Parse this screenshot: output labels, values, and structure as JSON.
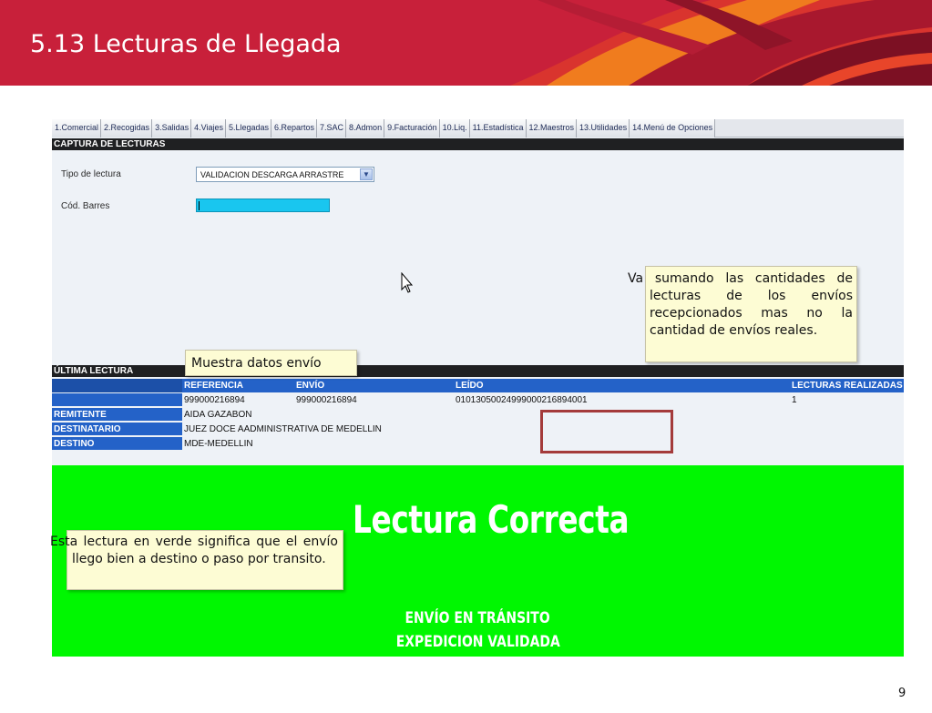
{
  "slide": {
    "title": "5.13 Lecturas de Llegada",
    "page_number": "9",
    "banner_color": "#c8203a"
  },
  "tabs": [
    "1.Comercial",
    "2.Recogidas",
    "3.Salidas",
    "4.Viajes",
    "5.Llegadas",
    "6.Repartos",
    "7.SAC",
    "8.Admon",
    "9.Facturación",
    "10.Liq.",
    "11.Estadística",
    "12.Maestros",
    "13.Utilidades",
    "14.Menú de Opciones"
  ],
  "capture": {
    "section_title": "CAPTURA DE LECTURAS",
    "tipo_label": "Tipo de lectura",
    "tipo_value": "VALIDACION DESCARGA ARRASTRE",
    "barcode_label": "Cód. Barres"
  },
  "ultima": {
    "section_title": "ÚLTIMA LECTURA",
    "headers": {
      "referencia": "REFERENCIA",
      "envio": "ENVÍO",
      "leido": "LEÍDO",
      "lecturas": "LECTURAS REALIZADAS"
    },
    "values": {
      "referencia": "999000216894",
      "envio": "999000216894",
      "leido": "01013050024999000216894001",
      "lecturas": "1"
    },
    "remitente_label": "REMITENTE",
    "remitente_value": "AIDA GAZABON",
    "destinatario_label": "DESTINATARIO",
    "destinatario_value": "JUEZ DOCE AADMINISTRATIVA DE MEDELLIN",
    "destino_label": "DESTINO",
    "destino_value": "MDE-MEDELLIN"
  },
  "result": {
    "title": "Lectura Correcta",
    "line1": "ENVÍO EN TRÁNSITO",
    "line2": "EXPEDICION VALIDADA",
    "color": "#00f701"
  },
  "callouts": {
    "sumando": "Va sumando las cantidades de lecturas de los envíos recepcionados mas no la cantidad de envíos reales.",
    "muestra": "Muestra datos envío",
    "verde": "Esta lectura en verde significa que el envío llego bien a destino o paso por transito."
  }
}
